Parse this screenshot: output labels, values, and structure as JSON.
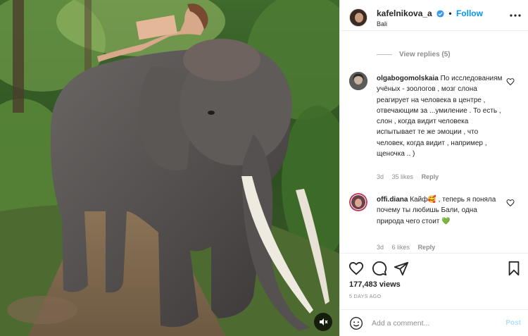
{
  "post": {
    "username": "kafelnikova_a",
    "follow_label": "Follow",
    "location": "Bali",
    "views": "177,483 views",
    "time_ago": "5 DAYS AGO"
  },
  "comments": {
    "view_replies": "View replies (5)",
    "items": [
      {
        "username": "olgabogomolskaia",
        "text": "По исследованиям учёных - зоологов , мозг слона реагирует на человека в центре , отвечающим за ...умиление . То есть , слон , когда видит человека испытывает те же эмоции , что человек, когда видит , например , щеночка .. )",
        "age": "3d",
        "likes": "35 likes",
        "reply": "Reply"
      },
      {
        "username": "offi.diana",
        "text": "Кайф🥰 , теперь я поняла почему ты любишь Бали, одна природа чего стоит 💚",
        "age": "3d",
        "likes": "6 likes",
        "reply": "Reply"
      }
    ]
  },
  "add_comment": {
    "placeholder": "Add a comment...",
    "post_label": "Post"
  },
  "icons": {
    "verified": "verified-badge-icon",
    "more": "more-options-icon",
    "like": "heart-icon",
    "comment": "comment-bubble-icon",
    "share": "paper-plane-icon",
    "save": "bookmark-icon",
    "emoji": "smiley-icon",
    "mute": "speaker-muted-icon"
  },
  "colors": {
    "accent": "#0095f6",
    "text": "#262626",
    "muted": "#8e8e8e",
    "post_disabled": "#b2dffc"
  }
}
